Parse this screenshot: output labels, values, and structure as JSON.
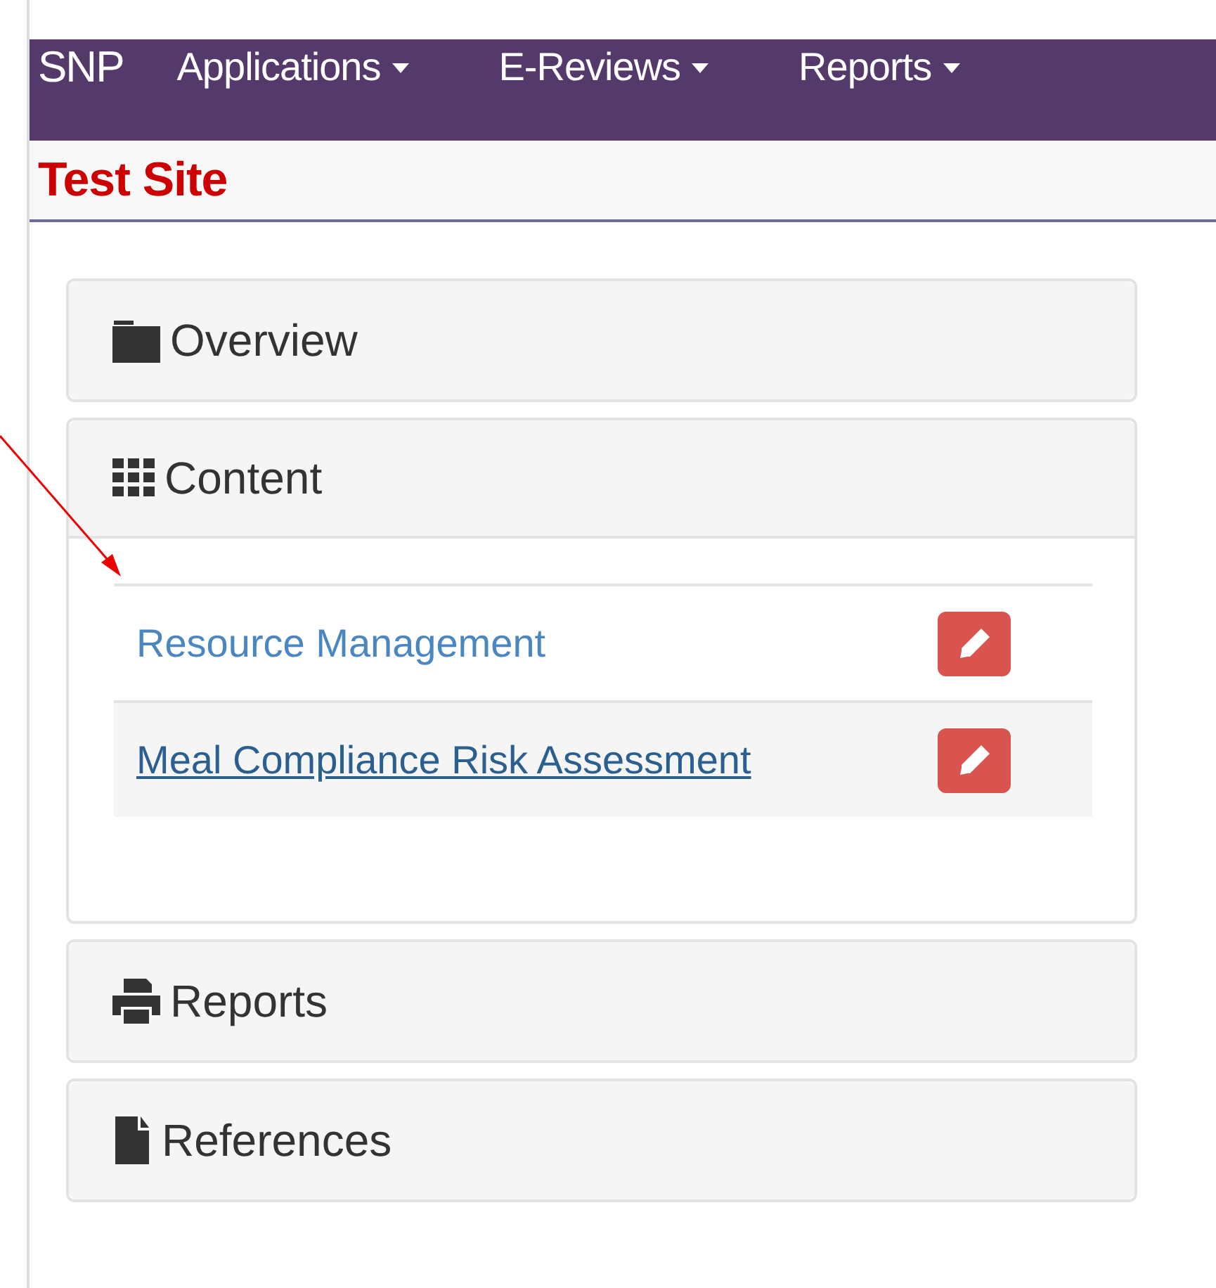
{
  "navbar": {
    "brand": "SNP",
    "menus": [
      {
        "label": "Applications"
      },
      {
        "label": "E-Reviews"
      },
      {
        "label": "Reports"
      }
    ]
  },
  "site_title": "Test Site",
  "panels": [
    {
      "title": "Overview",
      "expanded": false
    },
    {
      "title": "Content",
      "expanded": true,
      "items": [
        {
          "label": "Resource Management",
          "hovered": false
        },
        {
          "label": "Meal Compliance Risk Assessment",
          "hovered": true
        }
      ]
    },
    {
      "title": "Reports",
      "expanded": false
    },
    {
      "title": "References",
      "expanded": false
    }
  ]
}
